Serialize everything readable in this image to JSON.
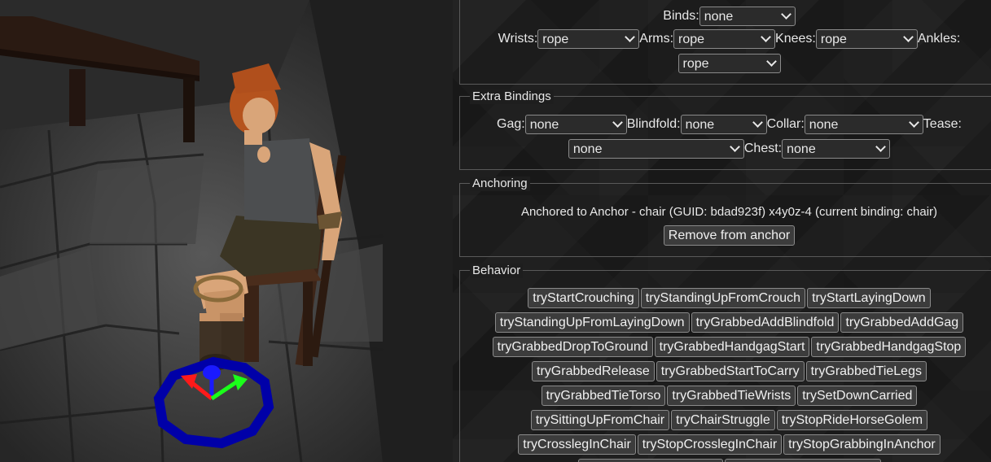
{
  "scene": {
    "gizmo_colors": {
      "x_axis": "#ff1a1a",
      "y_axis": "#1aff1a",
      "z_axis": "#1a1aff",
      "ring": "#0000a8"
    }
  },
  "binds": {
    "binds_label": "Binds:",
    "binds_value": "none",
    "wrists_label": "Wrists:",
    "wrists_value": "rope",
    "arms_label": "Arms:",
    "arms_value": "rope",
    "knees_label": "Knees:",
    "knees_value": "rope",
    "ankles_label": "Ankles:",
    "ankles_value": "rope"
  },
  "extra_bindings": {
    "title": "Extra Bindings",
    "gag_label": "Gag:",
    "gag_value": "none",
    "blindfold_label": "Blindfold:",
    "blindfold_value": "none",
    "collar_label": "Collar:",
    "collar_value": "none",
    "tease_label": "Tease:",
    "tease_value": "none",
    "chest_label": "Chest:",
    "chest_value": "none"
  },
  "anchoring": {
    "title": "Anchoring",
    "status": "Anchored to Anchor - chair (GUID: bdad923f) x4y0z-4 (current binding: chair)",
    "remove_button": "Remove from anchor"
  },
  "behavior": {
    "title": "Behavior",
    "rows": [
      [
        "tryStartCrouching",
        "tryStandingUpFromCrouch",
        "tryStartLayingDown"
      ],
      [
        "tryStandingUpFromLayingDown",
        "tryGrabbedAddBlindfold",
        "tryGrabbedAddGag"
      ],
      [
        "tryGrabbedDropToGround",
        "tryGrabbedHandgagStart",
        "tryGrabbedHandgagStop"
      ],
      [
        "tryGrabbedRelease",
        "tryGrabbedStartToCarry",
        "tryGrabbedTieLegs"
      ],
      [
        "tryGrabbedTieTorso",
        "tryGrabbedTieWrists",
        "trySetDownCarried"
      ],
      [
        "trySittingUpFromChair",
        "tryChairStruggle",
        "tryStopRideHorseGolem"
      ],
      [
        "tryCrosslegInChair",
        "tryStopCrosslegInChair",
        "tryStopGrabbingInAnchor"
      ]
    ]
  }
}
